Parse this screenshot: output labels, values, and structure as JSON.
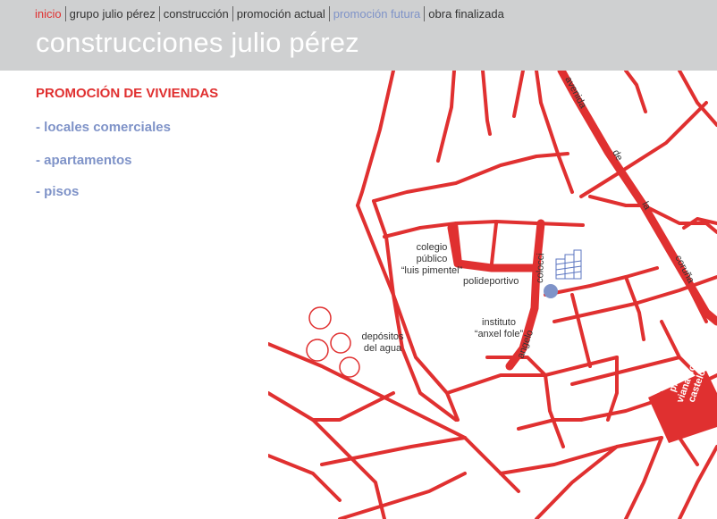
{
  "nav": {
    "items": [
      {
        "label": "inicio",
        "color": "#e03030"
      },
      {
        "label": "grupo julio pérez",
        "color": "#333333"
      },
      {
        "label": "construcción",
        "color": "#333333"
      },
      {
        "label": "promoción actual",
        "color": "#333333"
      },
      {
        "label": "promoción futura",
        "color": "#7f93c8"
      },
      {
        "label": "obra finalizada",
        "color": "#333333"
      }
    ]
  },
  "site": {
    "title": "construcciones julio pérez"
  },
  "promo": {
    "title": "PROMOCIÓN DE VIVIENDAS",
    "links": [
      "- locales comerciales",
      "- apartamentos",
      "- pisos"
    ]
  },
  "map": {
    "road_color": "#e03030",
    "marker_color": "#7f93c8",
    "labels": {
      "colegio_1": "colegio",
      "colegio_2": "público",
      "colegio_3": "“luis pimentel”",
      "polideportivo": "polideportivo",
      "instituto_1": "instituto",
      "instituto_2": "“anxel fole”",
      "depositos_1": "depósitos",
      "depositos_2": "del agua",
      "street_avenida": [
        "avenida",
        "de",
        "la",
        "coruña"
      ],
      "street_angelo": "angelo",
      "street_colocci": "colocci",
      "plaza": [
        "plaza",
        "viana do",
        "castelo"
      ]
    }
  }
}
